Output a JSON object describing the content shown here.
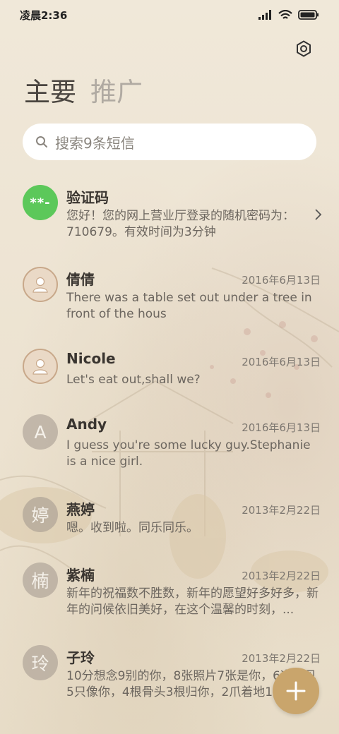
{
  "status_bar": {
    "time": "凌晨2:36"
  },
  "tabs": [
    {
      "label": "主要"
    },
    {
      "label": "推广"
    }
  ],
  "search": {
    "placeholder": "搜索9条短信"
  },
  "conversations": [
    {
      "name": "验证码",
      "avatar": "**-",
      "avatar_type": "code",
      "date": "",
      "preview": "您好！您的网上营业厅登录的随机密码为：710679。有效时间为3分钟"
    },
    {
      "name": "倩倩",
      "avatar_type": "person",
      "date": "2016年6月13日",
      "preview": "There was a table set out under a tree in front of the hous"
    },
    {
      "name": "Nicole",
      "avatar_type": "person",
      "date": "2016年6月13日",
      "preview": "Let's eat out,shall we?"
    },
    {
      "name": "Andy",
      "avatar": "A",
      "avatar_type": "letter",
      "date": "2016年6月13日",
      "preview": "I guess you're some lucky guy.Stephanie is a nice girl."
    },
    {
      "name": "燕婷",
      "avatar": "婷",
      "avatar_type": "letter",
      "date": "2013年2月22日",
      "preview": "嗯。收到啦。同乐同乐。"
    },
    {
      "name": "紫楠",
      "avatar": "楠",
      "avatar_type": "letter",
      "date": "2013年2月22日",
      "preview": "新年的祝福数不胜数，新年的愿望好多好多，新年的问候依旧美好，在这个温馨的时刻，..."
    },
    {
      "name": "子玲",
      "avatar": "玲",
      "avatar_type": "letter",
      "date": "2013年2月22日",
      "preview": "10分想念9别的你，8张照片7张是你，6次梦见5只像你，4根骨头3根归你，2爪着地1只..."
    }
  ],
  "colors": {
    "accent": "#c9a56c",
    "code_avatar": "#5cc85a",
    "background": "#efe6d6"
  },
  "icons": {
    "settings": "gear-icon",
    "search": "search-icon",
    "chevron": "chevron-right-icon",
    "compose": "plus-icon"
  }
}
